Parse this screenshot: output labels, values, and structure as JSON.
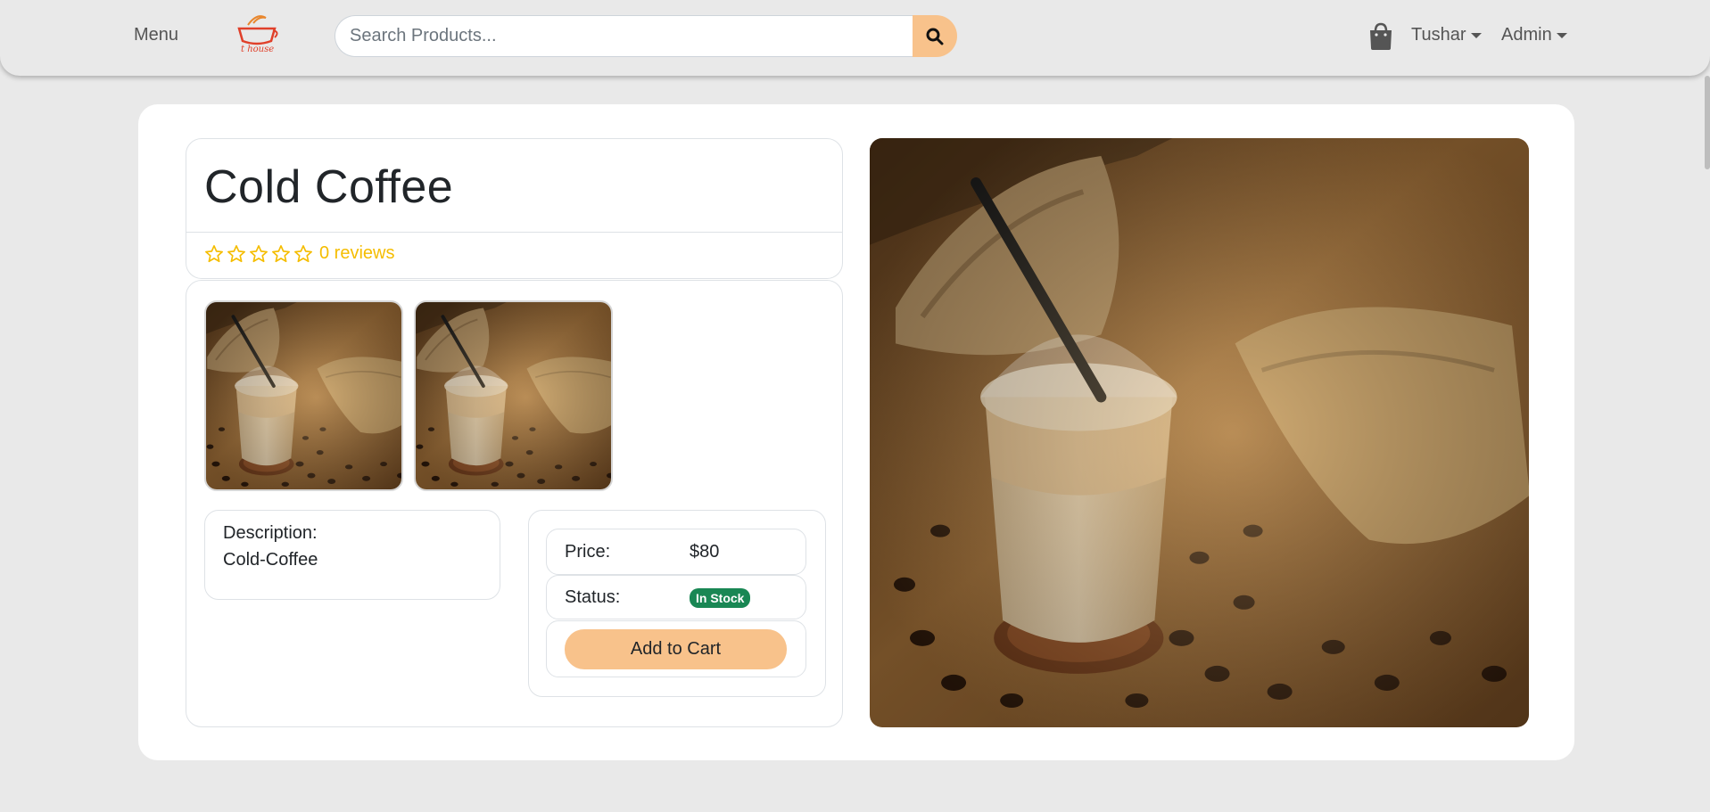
{
  "nav": {
    "menu_label": "Menu",
    "logo_text": "t house",
    "search_placeholder": "Search Products...",
    "user_label": "Tushar",
    "admin_label": "Admin",
    "icons": {
      "search": "search-icon",
      "cart": "shopping-bag-icon"
    }
  },
  "product": {
    "title": "Cold Coffee",
    "rating": {
      "stars": 0,
      "max_stars": 5,
      "reviews_label": "0 reviews"
    },
    "description_label": "Description:",
    "description_value": "Cold-Coffee",
    "price_label": "Price:",
    "price_value": "$80",
    "status_label": "Status:",
    "status_value": "In Stock",
    "add_to_cart_label": "Add to Cart",
    "thumbnail_count": 2
  },
  "colors": {
    "accent": "#f8c28b",
    "star": "#f5bd00",
    "status_badge": "#198754",
    "background": "#e9e9e9"
  }
}
